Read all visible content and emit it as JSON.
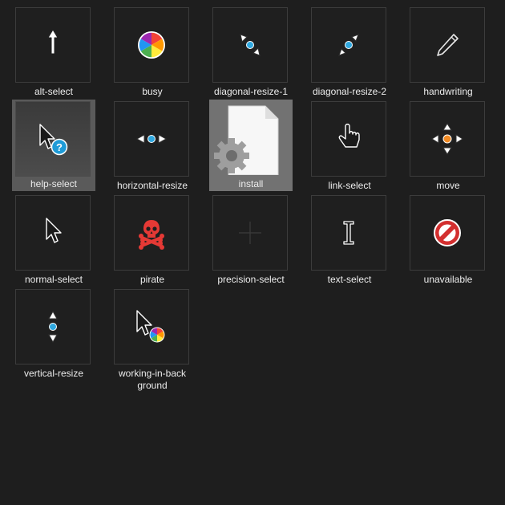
{
  "window": {
    "background": "#1e1e1e"
  },
  "items": [
    {
      "label": "alt-select",
      "icon": "up-arrow-icon"
    },
    {
      "label": "busy",
      "icon": "spinning-wheel-icon"
    },
    {
      "label": "diagonal-resize-1",
      "icon": "diagonal-resize-nwse-icon"
    },
    {
      "label": "diagonal-resize-2",
      "icon": "diagonal-resize-nesw-icon"
    },
    {
      "label": "handwriting",
      "icon": "pencil-icon"
    },
    {
      "label": "help-select",
      "icon": "help-arrow-icon",
      "state": "selected"
    },
    {
      "label": "horizontal-resize",
      "icon": "horizontal-resize-icon"
    },
    {
      "label": "install",
      "icon": "settings-file-icon",
      "state": "hovered"
    },
    {
      "label": "link-select",
      "icon": "hand-pointer-icon"
    },
    {
      "label": "move",
      "icon": "move-icon"
    },
    {
      "label": "normal-select",
      "icon": "arrow-pointer-icon"
    },
    {
      "label": "pirate",
      "icon": "skull-crossbones-icon"
    },
    {
      "label": "precision-select",
      "icon": "crosshair-icon"
    },
    {
      "label": "text-select",
      "icon": "i-beam-icon"
    },
    {
      "label": "unavailable",
      "icon": "no-entry-icon"
    },
    {
      "label": "vertical-resize",
      "icon": "vertical-resize-icon"
    },
    {
      "label": "working-in-back\nground",
      "icon": "arrow-busy-icon"
    }
  ],
  "colors": {
    "accent_blue": "#1e9bd7",
    "pirate_red": "#e53935",
    "unavailable_red": "#d32f2f",
    "move_orange": "#f08a24"
  }
}
